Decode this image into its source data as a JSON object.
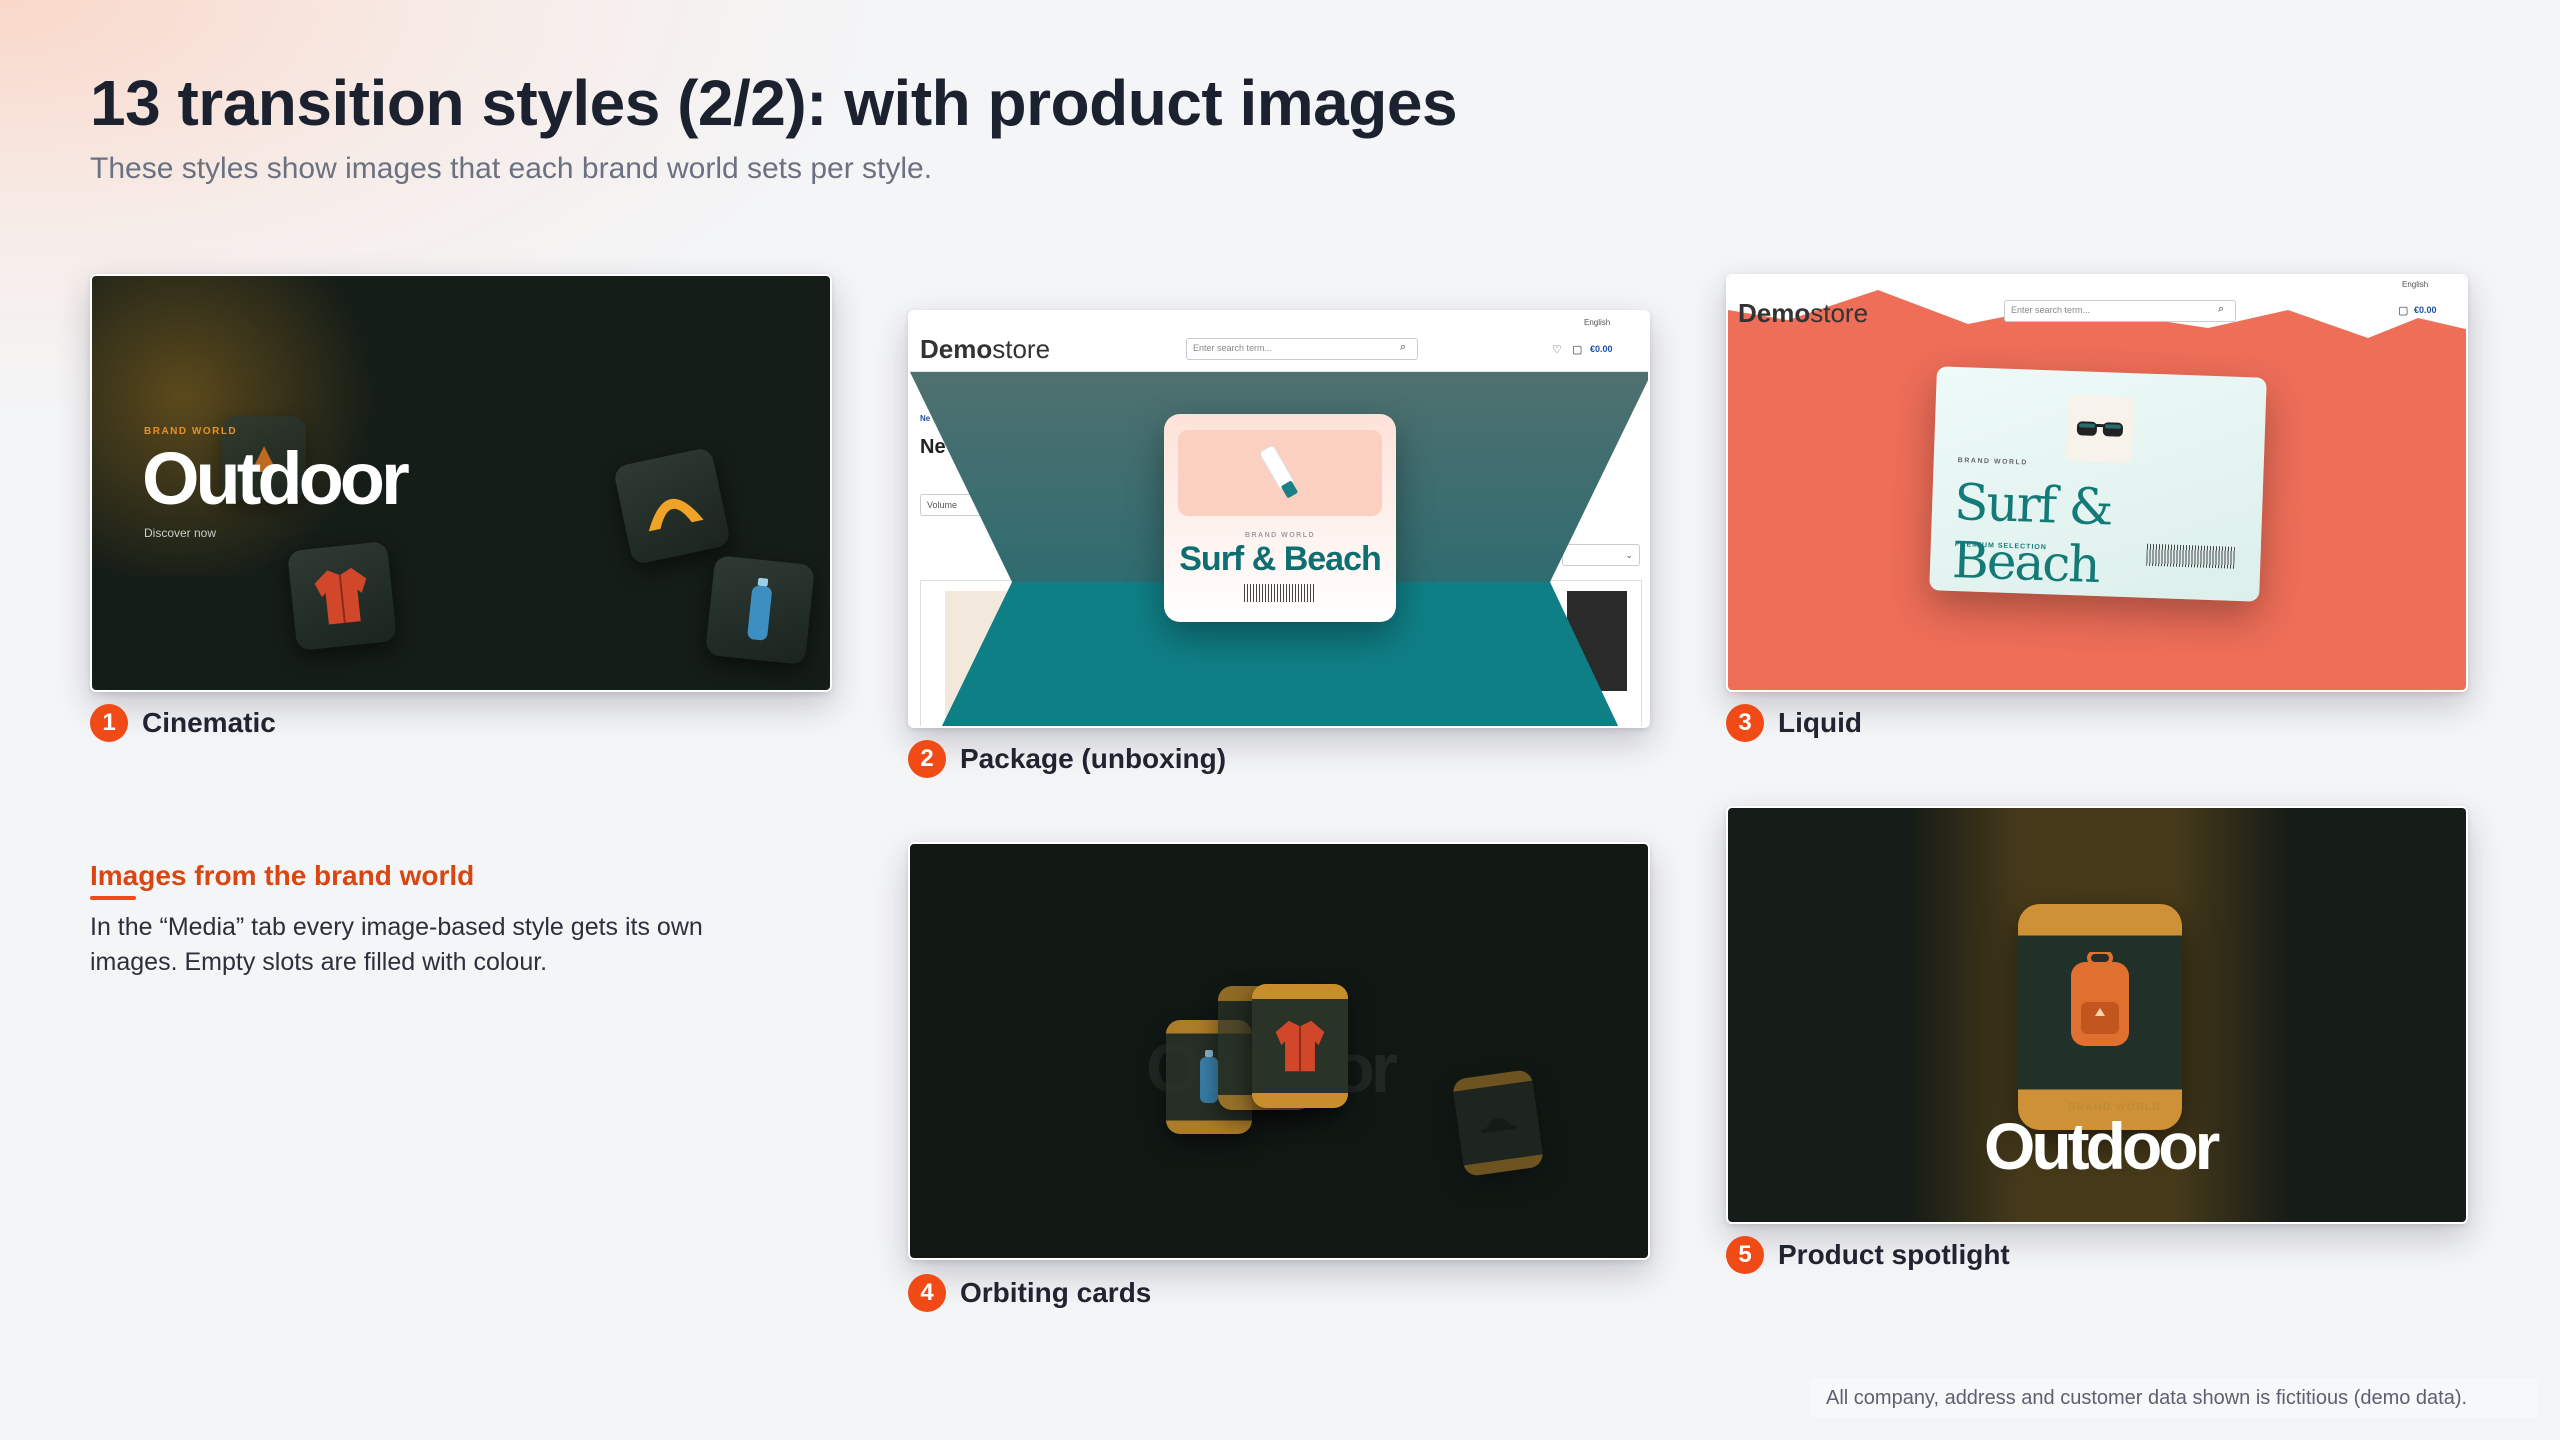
{
  "header": {
    "title": "13 transition styles (2/2): with product images",
    "subtitle": "These styles show images that each brand world sets per style."
  },
  "cards": [
    {
      "number": "1",
      "label": "Cinematic",
      "brand_world": "BRAND WORLD",
      "world_name": "Outdoor",
      "cta": "Discover now"
    },
    {
      "number": "2",
      "label": "Package (unboxing)",
      "brand_world": "BRAND WORLD",
      "world_name": "Surf & Beach"
    },
    {
      "number": "3",
      "label": "Liquid",
      "brand_world": "BRAND WORLD",
      "world_name": "Surf & Beach",
      "badge": "PREMIUM SELECTION"
    },
    {
      "number": "4",
      "label": "Orbiting cards",
      "world_name": "Outdoor"
    },
    {
      "number": "5",
      "label": "Product spotlight",
      "brand_world": "BRAND WORLD",
      "world_name": "Outdoor"
    }
  ],
  "shop": {
    "logo_bold": "Demo",
    "logo_rest": "store",
    "search_placeholder": "Enter search term...",
    "language": "English",
    "cart_total": "€0.00",
    "nav_short": "Ne",
    "breadcrumb_short": "Ne",
    "volume_label": "Volume"
  },
  "info": {
    "title": "Images from the brand world",
    "text": "In the “Media” tab every image-based style gets its own images. Empty slots are filled with colour."
  },
  "footer": {
    "disclaimer": "All company, address and customer data shown is fictitious (demo data)."
  },
  "colors": {
    "accent": "#f04a16",
    "accent_text": "#d94611",
    "teal": "#0e6e72",
    "liquid_bg": "#ee6e58",
    "dark_bg": "#151d18",
    "gold": "#c88e2c"
  },
  "icons": {
    "tent": "tent-icon",
    "jacket": "jacket-icon",
    "bottle": "bottle-icon",
    "sunscreen": "sunscreen-icon",
    "sunglasses": "sunglasses-icon",
    "backpack": "backpack-icon",
    "cap": "cap-icon"
  }
}
